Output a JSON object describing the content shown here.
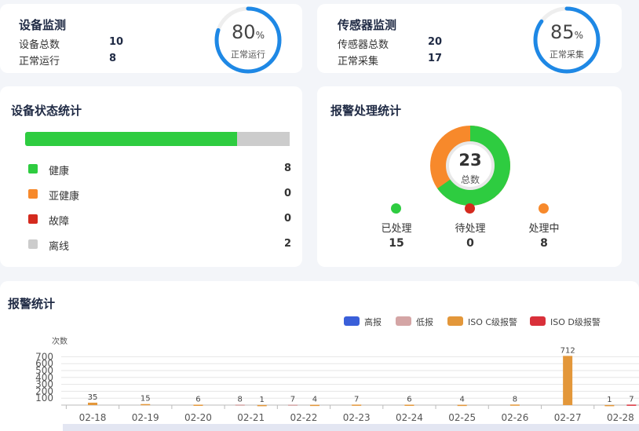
{
  "device_monitor": {
    "title": "设备监测",
    "total_label": "设备总数",
    "total_value": "10",
    "running_label": "正常运行",
    "running_value": "8",
    "gauge_value": "80",
    "gauge_unit": "%",
    "gauge_label": "正常运行",
    "gauge_fraction": 0.8,
    "color": "#1e88e5"
  },
  "sensor_monitor": {
    "title": "传感器监测",
    "total_label": "传感器总数",
    "total_value": "20",
    "collect_label": "正常采集",
    "collect_value": "17",
    "gauge_value": "85",
    "gauge_unit": "%",
    "gauge_label": "正常采集",
    "gauge_fraction": 0.85,
    "color": "#1e88e5"
  },
  "device_status": {
    "title": "设备状态统计",
    "bar_fraction": 0.8,
    "bar_color": "#2ecc40",
    "bar_rest_color": "#cccccc",
    "items": [
      {
        "label": "健康",
        "value": "8",
        "color": "#2ecc40"
      },
      {
        "label": "亚健康",
        "value": "0",
        "color": "#f7892b"
      },
      {
        "label": "故障",
        "value": "0",
        "color": "#d42a1e"
      },
      {
        "label": "离线",
        "value": "2",
        "color": "#cccccc"
      }
    ]
  },
  "alarm_handling": {
    "title": "报警处理统计",
    "total_value": "23",
    "total_label": "总数",
    "items": [
      {
        "label": "已处理",
        "value": "15",
        "color": "#2ecc40"
      },
      {
        "label": "待处理",
        "value": "0",
        "color": "#d42a1e"
      },
      {
        "label": "处理中",
        "value": "8",
        "color": "#f7892b"
      }
    ]
  },
  "alarm_stats": {
    "title": "报警统计",
    "y_unit": "次数"
  },
  "chart_data": {
    "type": "bar",
    "categories": [
      "02-18",
      "02-19",
      "02-20",
      "02-21",
      "02-22",
      "02-23",
      "02-24",
      "02-25",
      "02-26",
      "02-27",
      "02-28"
    ],
    "series": [
      {
        "name": "高报",
        "color": "#3a5fd9",
        "values": [
          null,
          null,
          null,
          null,
          null,
          null,
          null,
          null,
          null,
          null,
          null
        ]
      },
      {
        "name": "低报",
        "color": "#d4a5a5",
        "values": [
          null,
          null,
          null,
          8,
          7,
          null,
          null,
          null,
          null,
          null,
          null
        ]
      },
      {
        "name": "ISO C级报警",
        "color": "#e3973a",
        "values": [
          35,
          15,
          6,
          1,
          4,
          7,
          6,
          4,
          8,
          712,
          1
        ]
      },
      {
        "name": "ISO D级报警",
        "color": "#d9303a",
        "values": [
          null,
          null,
          null,
          null,
          null,
          null,
          null,
          null,
          null,
          null,
          7
        ]
      }
    ],
    "y_ticks": [
      "100",
      "200",
      "300",
      "400",
      "500",
      "600",
      "700"
    ],
    "ylim": [
      0,
      750
    ],
    "grid": true,
    "legend_position": "top-right"
  }
}
